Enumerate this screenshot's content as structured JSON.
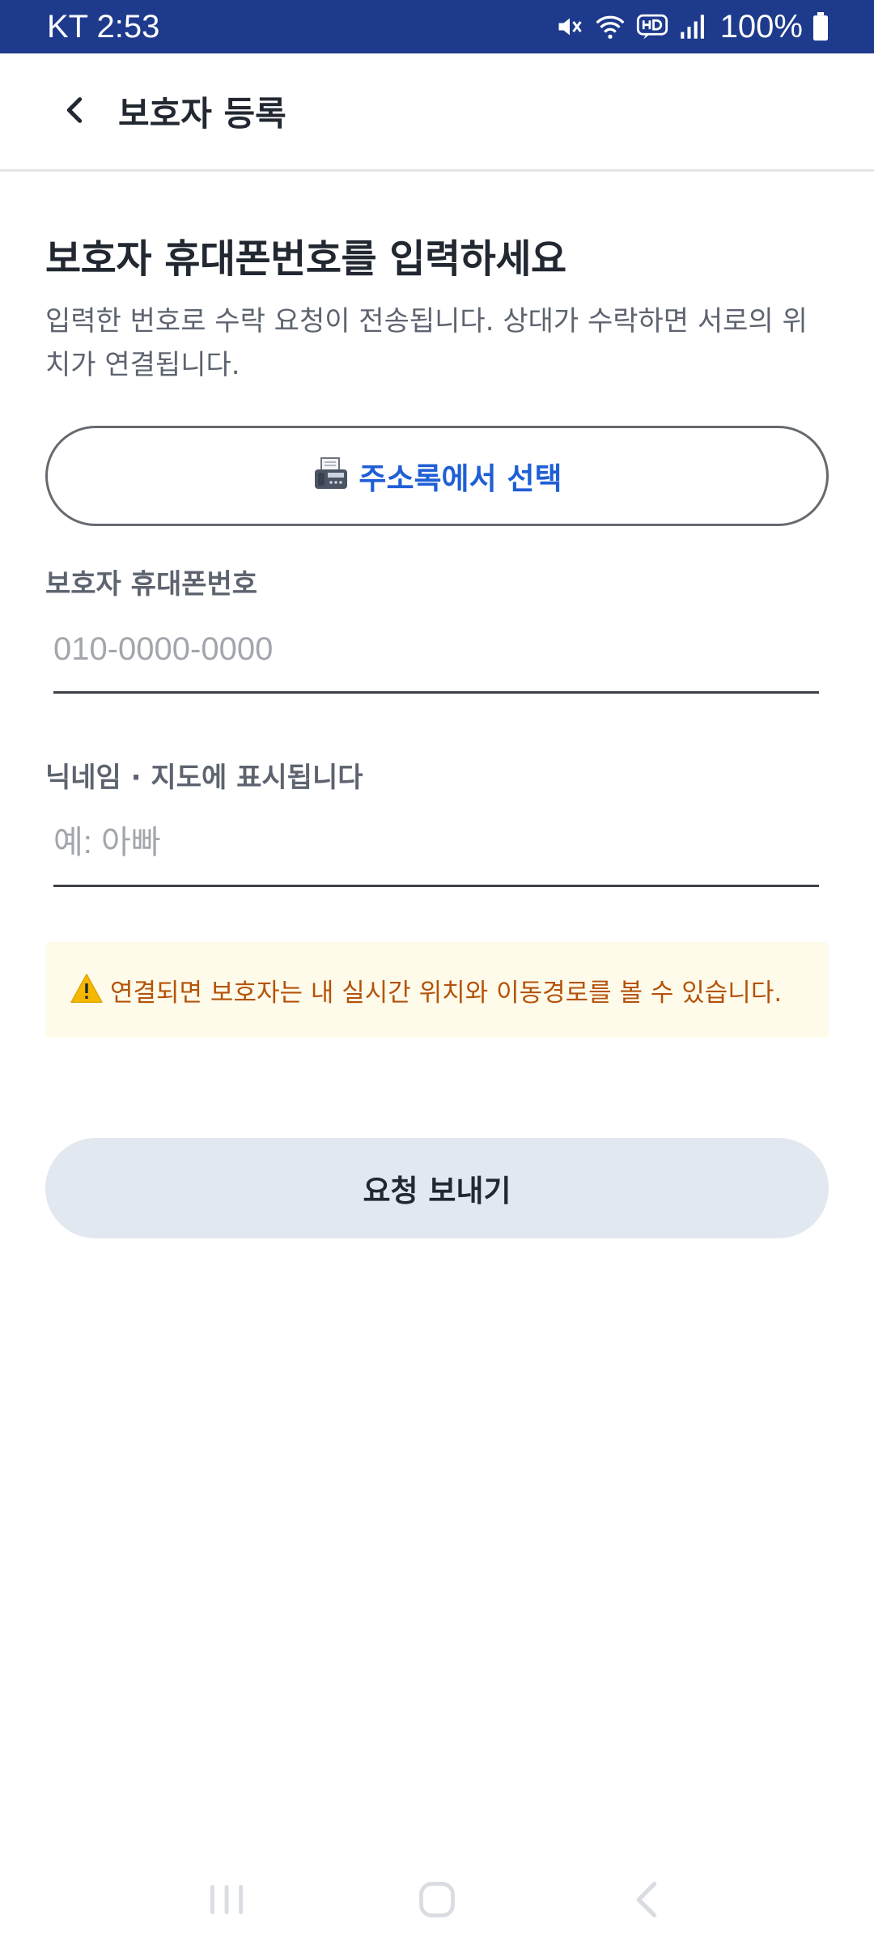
{
  "status_bar": {
    "carrier_time": "KT 2:53",
    "battery": "100%",
    "icons": [
      "mute-icon",
      "wifi-icon",
      "hd-icon",
      "signal-icon",
      "battery-icon"
    ]
  },
  "header": {
    "back_icon": "chevron-left-icon",
    "title": "보호자 등록"
  },
  "form": {
    "title": "보호자 휴대폰번호를 입력하세요",
    "description": "입력한 번호로 수락 요청이 전송됩니다. 상대가 수락하면 서로의 위치가 연결됩니다.",
    "contacts_button": {
      "icon": "fax-icon",
      "label": "주소록에서 선택"
    },
    "phone": {
      "label": "보호자 휴대폰번호",
      "value": "",
      "placeholder": "010-0000-0000"
    },
    "nickname": {
      "label": "닉네임 · 지도에 표시됩니다",
      "value": "",
      "placeholder": "예: 아빠"
    },
    "warning": {
      "icon": "warning-icon",
      "text": "연결되면 보호자는 내 실시간 위치와 이동경로를 볼 수 있습니다."
    },
    "submit_label": "요청 보내기"
  },
  "nav_bar": {
    "icons": [
      "recent-apps-icon",
      "home-icon",
      "back-icon"
    ]
  },
  "colors": {
    "status_bar_bg": "#1d3a8c",
    "accent": "#1f5fd6",
    "warning_bg": "#fffbeb",
    "warning_text": "#b4530a",
    "submit_bg": "#e2e8f0"
  }
}
